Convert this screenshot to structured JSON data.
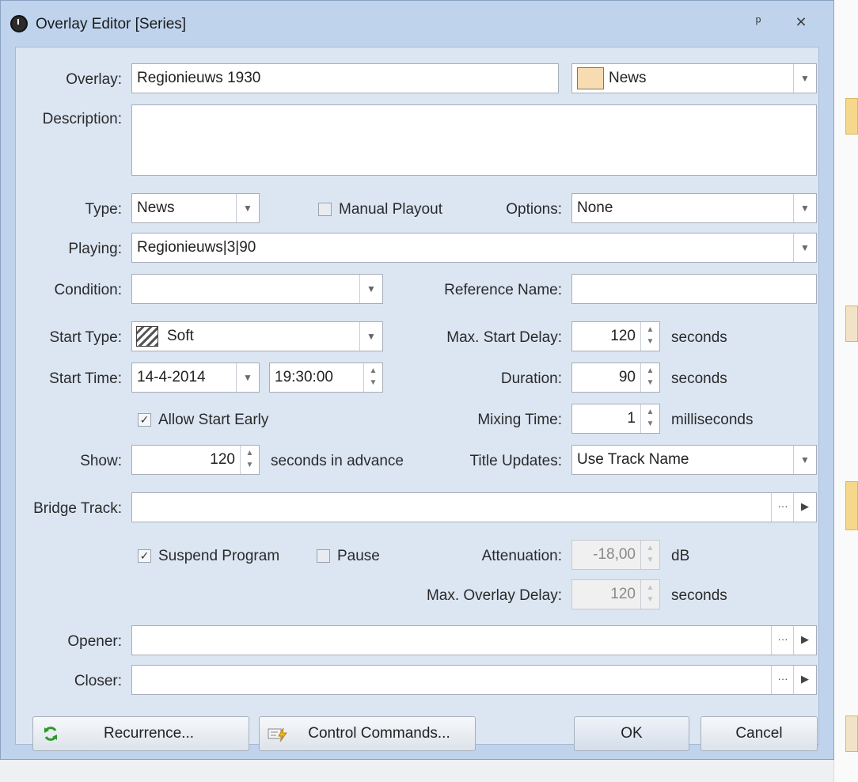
{
  "window": {
    "title": "Overlay Editor [Series]",
    "pin_glyph": "ᵖ",
    "close_glyph": "⨯"
  },
  "labels": {
    "overlay": "Overlay:",
    "description": "Description:",
    "type": "Type:",
    "options": "Options:",
    "playing": "Playing:",
    "condition": "Condition:",
    "reference_name": "Reference Name:",
    "start_type": "Start Type:",
    "max_start_delay": "Max. Start Delay:",
    "start_time": "Start Time:",
    "duration": "Duration:",
    "mixing_time": "Mixing Time:",
    "show": "Show:",
    "title_updates": "Title Updates:",
    "bridge_track": "Bridge Track:",
    "attenuation": "Attenuation:",
    "max_overlay_delay": "Max. Overlay Delay:",
    "opener": "Opener:",
    "closer": "Closer:"
  },
  "units": {
    "seconds": "seconds",
    "milliseconds": "milliseconds",
    "seconds_in_advance": "seconds in advance",
    "db": "dB"
  },
  "fields": {
    "overlay": "Regionieuws 1930",
    "category": "News",
    "description": "",
    "type": "News",
    "options": "None",
    "playing": "Regionieuws|3|90",
    "condition": "",
    "reference_name": "",
    "start_type": "Soft",
    "max_start_delay": "120",
    "start_date": "14-4-2014",
    "start_time": "19:30:00",
    "duration": "90",
    "mixing_time": "1",
    "show": "120",
    "title_updates": "Use Track Name",
    "bridge_track": "",
    "attenuation": "-18,00",
    "max_overlay_delay": "120",
    "opener": "",
    "closer": ""
  },
  "checks": {
    "manual_playout": {
      "label": "Manual Playout",
      "checked": false
    },
    "allow_start_early": {
      "label": "Allow Start Early",
      "checked": true
    },
    "suspend_program": {
      "label": "Suspend Program",
      "checked": true
    },
    "pause": {
      "label": "Pause",
      "checked": false
    }
  },
  "buttons": {
    "recurrence": "Recurrence...",
    "control_commands": "Control Commands...",
    "ok": "OK",
    "cancel": "Cancel"
  },
  "colors": {
    "category_swatch": "#f6dcb0",
    "window_bg": "#bfd3ec",
    "panel_bg": "#dce6f3"
  }
}
